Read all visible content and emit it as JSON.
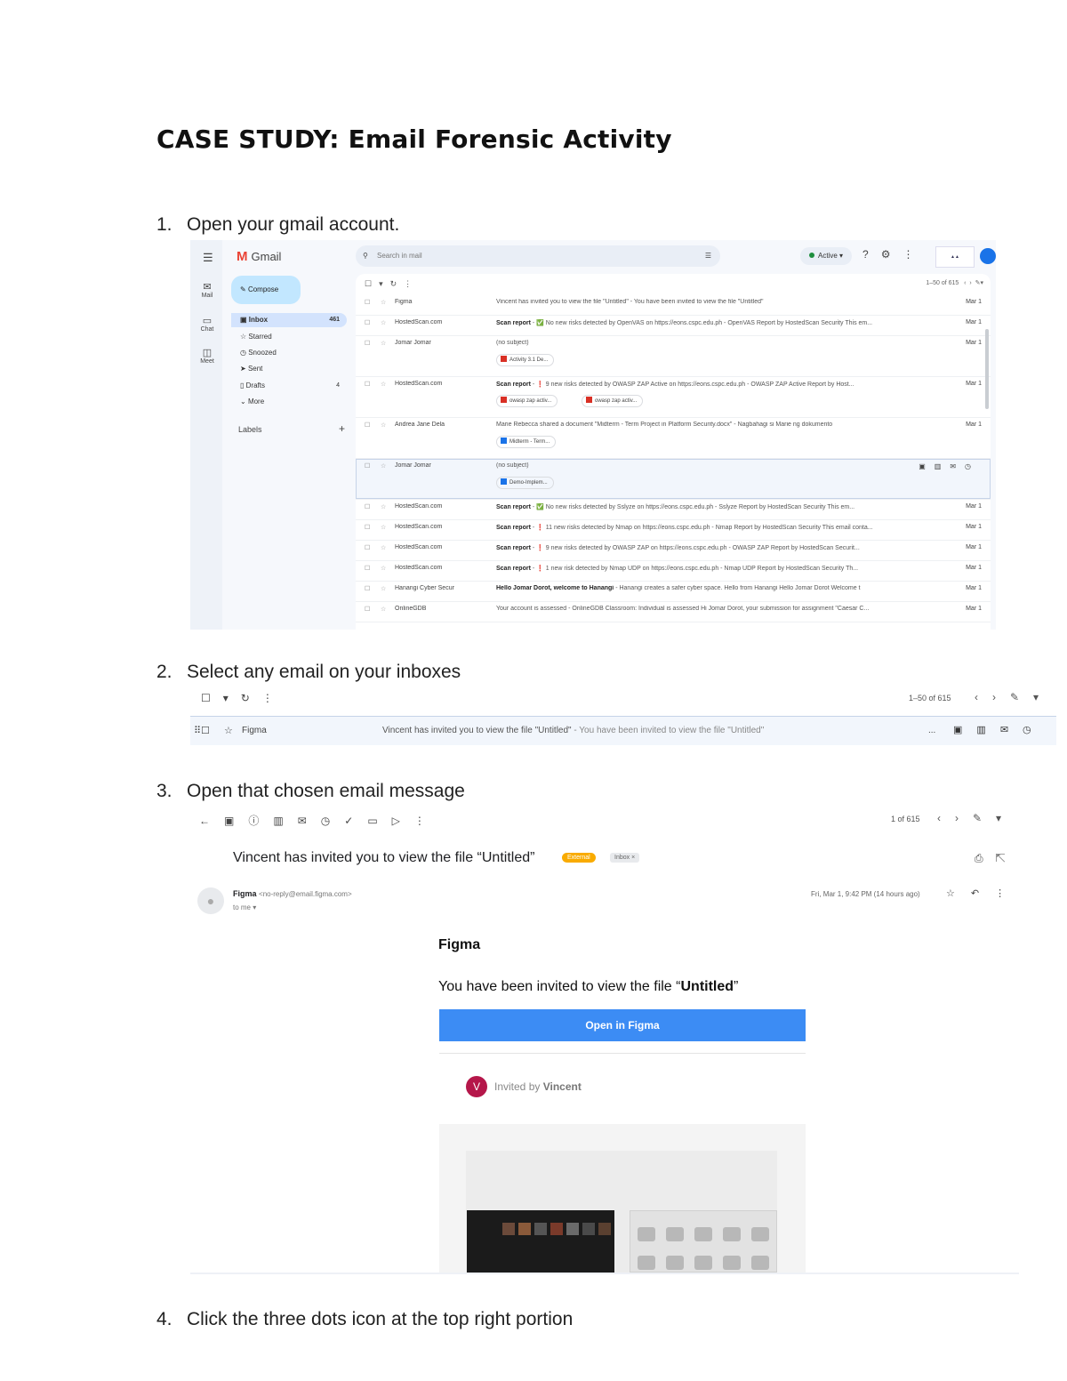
{
  "doc_title": "CASE STUDY: Email Forensic Activity",
  "steps": [
    {
      "num": "1.",
      "text": "Open your gmail account."
    },
    {
      "num": "2.",
      "text": "Select any email on your inboxes"
    },
    {
      "num": "3.",
      "text": "Open that chosen email message"
    },
    {
      "num": "4.",
      "text": "Click the three dots icon at the top right portion"
    }
  ],
  "gmail": {
    "app_name": "Gmail",
    "search_placeholder": "Search in mail",
    "status": "Active",
    "compose": "Compose",
    "rail": [
      "Mail",
      "Chat",
      "Meet"
    ],
    "nav": [
      {
        "label": "Inbox",
        "count": "461"
      },
      {
        "label": "Starred",
        "count": ""
      },
      {
        "label": "Snoozed",
        "count": ""
      },
      {
        "label": "Sent",
        "count": ""
      },
      {
        "label": "Drafts",
        "count": "4"
      },
      {
        "label": "More",
        "count": ""
      }
    ],
    "labels_heading": "Labels",
    "pager": "1–50 of 615",
    "rows": [
      {
        "sender": "Figma",
        "subject_bold": "",
        "subject": "Vincent has invited you to view the file \"Untitled\" - You have been invited to view the file \"Untitled\"",
        "date": "Mar 1"
      },
      {
        "sender": "HostedScan.com",
        "subject_bold": "Scan report",
        "subject": " - ✅ No new risks detected by OpenVAS on https://eons.cspc.edu.ph - OpenVAS Report by HostedScan Security This em...",
        "date": "Mar 1"
      },
      {
        "sender": "Jomar Jomar",
        "subject_bold": "",
        "subject": "(no subject)",
        "date": "Mar 1",
        "chips": [
          "Activity 3.1 De..."
        ]
      },
      {
        "sender": "HostedScan.com",
        "subject_bold": "Scan report",
        "subject": " - ❗ 9 new risks detected by OWASP ZAP Active on https://eons.cspc.edu.ph - OWASP ZAP Active Report by Host...",
        "date": "Mar 1",
        "chips": [
          "owasp zap activ...",
          "owasp zap activ..."
        ]
      },
      {
        "sender": "Andrea Jane Dela",
        "subject_bold": "",
        "subject": "Marie Rebecca shared a document \"Midterm - Term Project in Platform Security.docx\" - Nagbahagi si Marie ng dokumento",
        "date": "Mar 1",
        "chips": [
          "Midterm - Term..."
        ]
      },
      {
        "sender": "Jomar Jomar",
        "subject_bold": "",
        "subject": "(no subject)",
        "date": "",
        "chips": [
          "Demo-Implem..."
        ],
        "hover": true
      },
      {
        "sender": "HostedScan.com",
        "subject_bold": "Scan report",
        "subject": " - ✅ No new risks detected by Sslyze on https://eons.cspc.edu.ph - Sslyze Report by HostedScan Security This em...",
        "date": "Mar 1"
      },
      {
        "sender": "HostedScan.com",
        "subject_bold": "Scan report",
        "subject": " - ❗ 11 new risks detected by Nmap on https://eons.cspc.edu.ph - Nmap Report by HostedScan Security This email conta...",
        "date": "Mar 1"
      },
      {
        "sender": "HostedScan.com",
        "subject_bold": "Scan report",
        "subject": " - ❗ 9 new risks detected by OWASP ZAP on https://eons.cspc.edu.ph - OWASP ZAP Report by HostedScan Securit...",
        "date": "Mar 1"
      },
      {
        "sender": "HostedScan.com",
        "subject_bold": "Scan report",
        "subject": " - ❗ 1 new risk detected by Nmap UDP on https://eons.cspc.edu.ph - Nmap UDP Report by HostedScan Security Th...",
        "date": "Mar 1"
      },
      {
        "sender": "Hanangi Cyber Secur",
        "subject_bold": "Hello Jomar Dorot, welcome to Hanangi",
        "subject": " - Hanangi creates a safer cyber space. Hello from Hanangi Hello Jomar Dorot Welcome t",
        "date": "Mar 1"
      },
      {
        "sender": "OnlineGDB",
        "subject_bold": "",
        "subject": "Your account is assessed - OnlineGDB Classroom: Individual is assessed Hi Jomar Dorot, your submission for assignment \"Caesar C...",
        "date": "Mar 1"
      }
    ]
  },
  "selected": {
    "pager": "1–50 of 615",
    "sender": "Figma",
    "subject": "Vincent has invited you to view the file \"Untitled\"",
    "snippet": " - You have been invited to view the file \"Untitled\"",
    "ellipsis": "..."
  },
  "message": {
    "pager": "1 of 615",
    "subject": "Vincent has invited you to view the file “Untitled”",
    "label_external": "External",
    "label_inbox": "Inbox ×",
    "sender_name": "Figma",
    "sender_email": "<no-reply@email.figma.com>",
    "to": "to me ▾",
    "date": "Fri, Mar 1, 9:42 PM (14 hours ago)",
    "brand": "Figma",
    "invite_prefix": "You have been invited to view the file “",
    "invite_file": "Untitled",
    "invite_suffix": "”",
    "button": "Open in Figma",
    "inviter_initial": "V",
    "invited_by_prefix": "Invited by ",
    "inviter": "Vincent"
  },
  "colors": {
    "accent": "#3c8cf4",
    "figma_avatar": "#b5174a",
    "external_label": "#f9ab00"
  }
}
